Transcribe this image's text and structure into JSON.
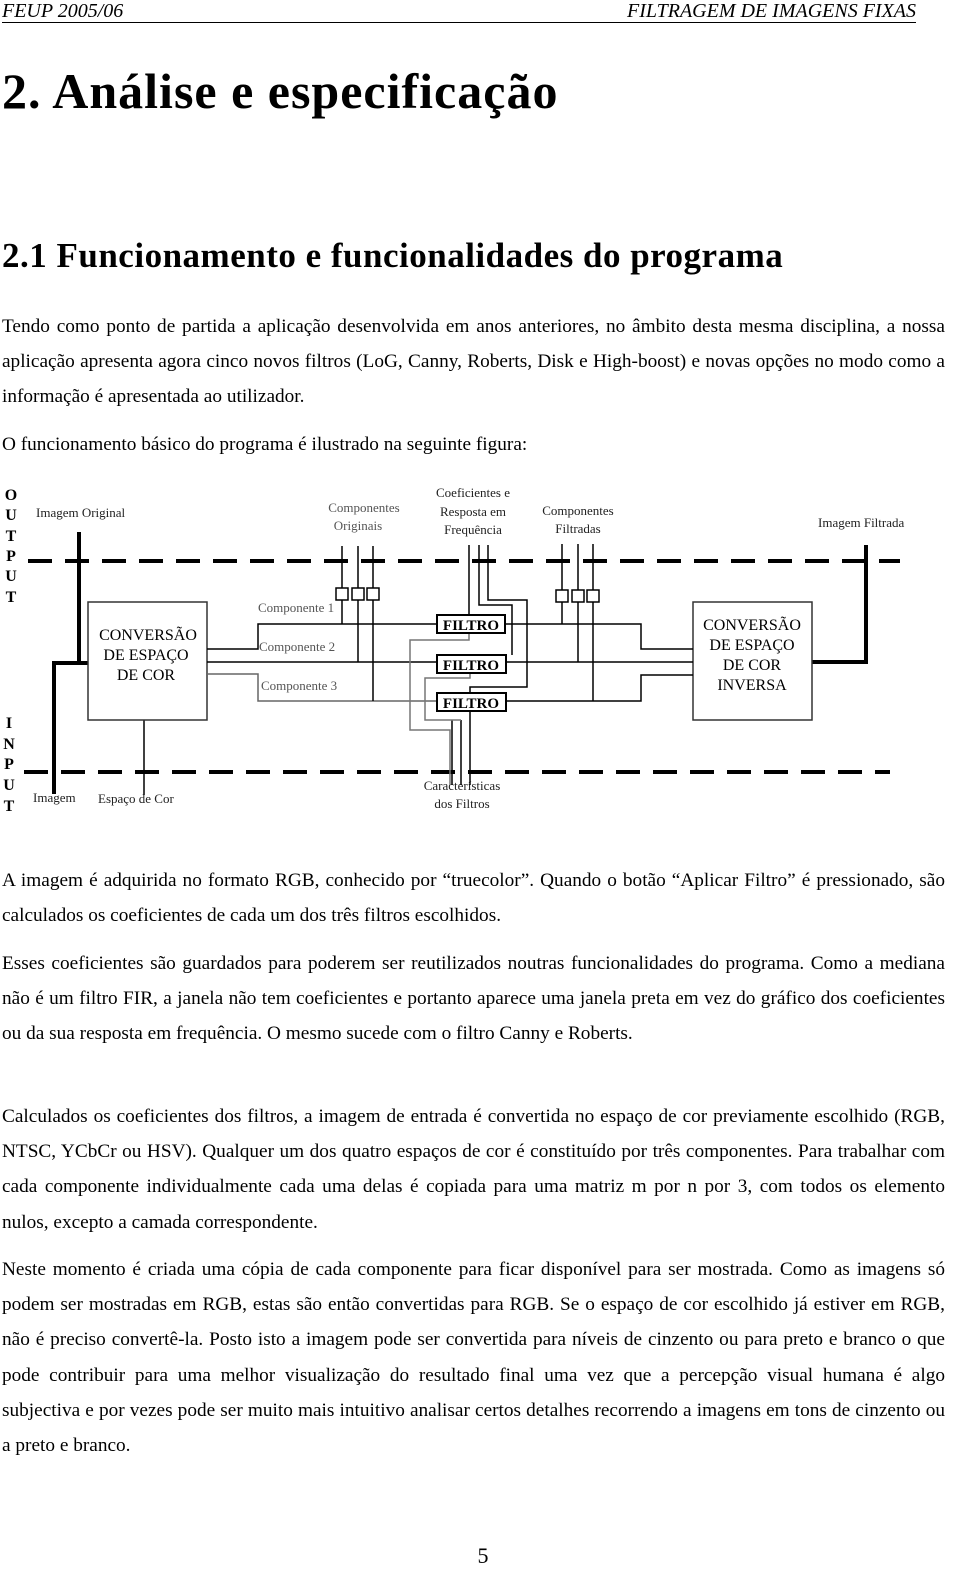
{
  "header": {
    "left": "FEUP 2005/06",
    "right": "FILTRAGEM DE IMAGENS FIXAS"
  },
  "title": "2. Análise e especificação",
  "section": "2.1 Funcionamento e funcionalidades do programa",
  "paragraphs": [
    "Tendo como ponto de partida a aplicação desenvolvida em anos anteriores, no âmbito desta mesma disciplina, a nossa aplicação apresenta agora cinco novos filtros (LoG, Canny, Roberts, Disk e High-boost) e novas opções no modo como a informação é apresentada ao utilizador.",
    "O funcionamento básico do programa é ilustrado na seguinte figura:",
    "A imagem é adquirida no formato RGB, conhecido por “truecolor”. Quando o botão “Aplicar Filtro” é pressionado, são calculados os coeficientes de cada um dos três filtros escolhidos.",
    "Esses coeficientes são guardados para poderem ser reutilizados noutras funcionalidades do programa. Como a mediana não é um filtro FIR, a janela não tem coeficientes e portanto aparece uma janela preta em vez do gráfico dos coeficientes ou da sua resposta em frequência. O mesmo sucede com o filtro Canny e Roberts.",
    "Calculados os coeficientes dos filtros, a imagem de entrada é convertida no espaço de cor previamente escolhido (RGB, NTSC, YCbCr ou HSV). Qualquer um dos quatro espaços de cor é constituído por três componentes. Para trabalhar com cada componente individualmente cada uma delas é copiada para uma matriz m por n por 3, com todos os elemento nulos, excepto a camada correspondente.",
    "Neste momento é criada uma cópia de cada componente para ficar disponível para ser mostrada. Como as imagens só podem ser mostradas em RGB, estas são então convertidas para RGB. Se o espaço de cor escolhido já estiver em RGB, não é preciso convertê-la. Posto isto a imagem pode ser convertida para níveis de cinzento ou para preto e branco o que pode contribuir para uma melhor visualização do resultado final uma vez que a percepção visual humana é algo subjectiva e por vezes pode ser muito mais intuitivo analisar certos detalhes recorrendo a imagens em tons de cinzento ou a preto e branco."
  ],
  "figure": {
    "output_letters": [
      "O",
      "U",
      "T",
      "P",
      "U",
      "T"
    ],
    "input_letters": [
      "I",
      "N",
      "P",
      "U",
      "T"
    ],
    "imagem_original": "Imagem Original",
    "componentes_originais": [
      "Componentes",
      "Originais"
    ],
    "coeficientes": [
      "Coeficientes e",
      "Resposta em",
      "Frequência"
    ],
    "componentes_filtradas": [
      "Componentes",
      "Filtradas"
    ],
    "imagem_filtrada": "Imagem Filtrada",
    "box1": [
      "CONVERSÃO",
      "DE ESPAÇO",
      "DE COR"
    ],
    "box2": [
      "CONVERSÃO",
      "DE ESPAÇO",
      "DE COR",
      "INVERSA"
    ],
    "componente1": "Componente 1",
    "componente2": "Componente 2",
    "componente3": "Componente 3",
    "filtro": "FILTRO",
    "imagem": "Imagem",
    "espaco_cor": "Espaço de Cor",
    "caracteristicas": [
      "Características",
      "dos Filtros"
    ]
  },
  "page_number": "5"
}
